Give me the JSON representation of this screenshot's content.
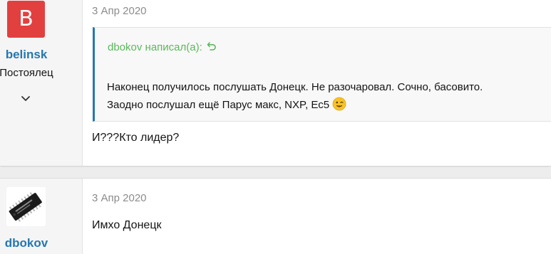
{
  "posts": [
    {
      "author": {
        "avatar_letter": "B",
        "avatar_color": "#e2403f",
        "name": "belinsk",
        "title": "Постоялец",
        "expand_icon": "chevron-down-icon"
      },
      "date": "3 Апр 2020",
      "quote": {
        "header": "dbokov написал(а):",
        "jump_icon": "reply-arrow-icon",
        "line1": "Наконец получилось послушать Донецк. Не разочаровал. Сочно, басовито.",
        "line2": "Заодно послушал ещё Парус макс, NXP, Ес5",
        "emoji": "wink-emoji-icon"
      },
      "message": "И???Кто лидер?"
    },
    {
      "author": {
        "avatar_image": "chip-avatar",
        "name": "dbokov"
      },
      "date": "3 Апр 2020",
      "message": "Имхо Донецк"
    }
  ],
  "colors": {
    "link": "#2577b1",
    "quote_header": "#5cb85c",
    "meta_text": "#8c8c8c"
  }
}
